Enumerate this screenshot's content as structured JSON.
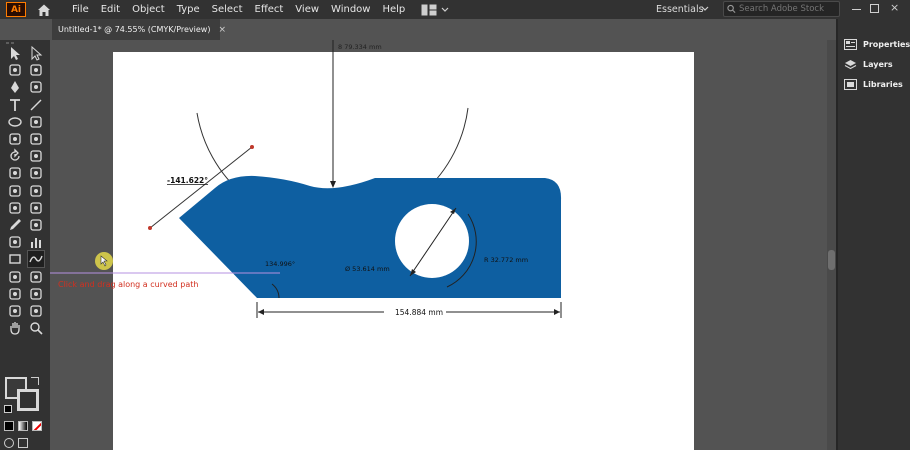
{
  "app": {
    "logo": "Ai",
    "menu": [
      "File",
      "Edit",
      "Object",
      "Type",
      "Select",
      "Effect",
      "View",
      "Window",
      "Help"
    ],
    "workspace": "Essentials",
    "search_placeholder": "Search Adobe Stock",
    "window_close": "×"
  },
  "document": {
    "tab_title": "Untitled-1* @ 74.55% (CMYK/Preview)",
    "tab_close": "×"
  },
  "panels": {
    "items": [
      "Properties",
      "Layers",
      "Libraries"
    ]
  },
  "tools": [
    "selection-tool-icon",
    "direct-selection-tool-icon",
    "magic-wand-tool-icon",
    "lasso-tool-icon",
    "pen-tool-icon",
    "curvature-tool-icon",
    "type-tool-icon",
    "line-segment-tool-icon",
    "ellipse-tool-icon",
    "paintbrush-tool-icon",
    "shaper-tool-icon",
    "eraser-tool-icon",
    "rotate-tool-icon",
    "scale-tool-icon",
    "warp-tool-icon",
    "free-transform-tool-icon",
    "shape-builder-tool-icon",
    "perspective-grid-tool-icon",
    "mesh-tool-icon",
    "gradient-tool-icon",
    "eyedropper-tool-icon",
    "blend-tool-icon",
    "symbol-sprayer-tool-icon",
    "column-graph-tool-icon",
    "rectangle-tool-icon",
    "dimension-tool-icon",
    "pencil-tool-icon",
    "width-tool-icon",
    "knife-tool-icon",
    "slice-tool-icon",
    "artboard-tool-icon",
    "smooth-tool-icon",
    "hand-tool-icon",
    "zoom-tool-icon"
  ],
  "canvas": {
    "dimensions": {
      "top_vertical": "8 79.334 mm",
      "angle": "-141.622°",
      "left_angle": "134.996°",
      "hole_diameter": "Ø 53.614 mm",
      "hole_radius": "R 32.772 mm",
      "bottom_width": "154.884 mm"
    },
    "hint_text": "Click and drag along a curved path"
  },
  "colors": {
    "shape_fill": "#0e5fa1",
    "dimension_line": "#222222",
    "guide": "#b690e0"
  }
}
